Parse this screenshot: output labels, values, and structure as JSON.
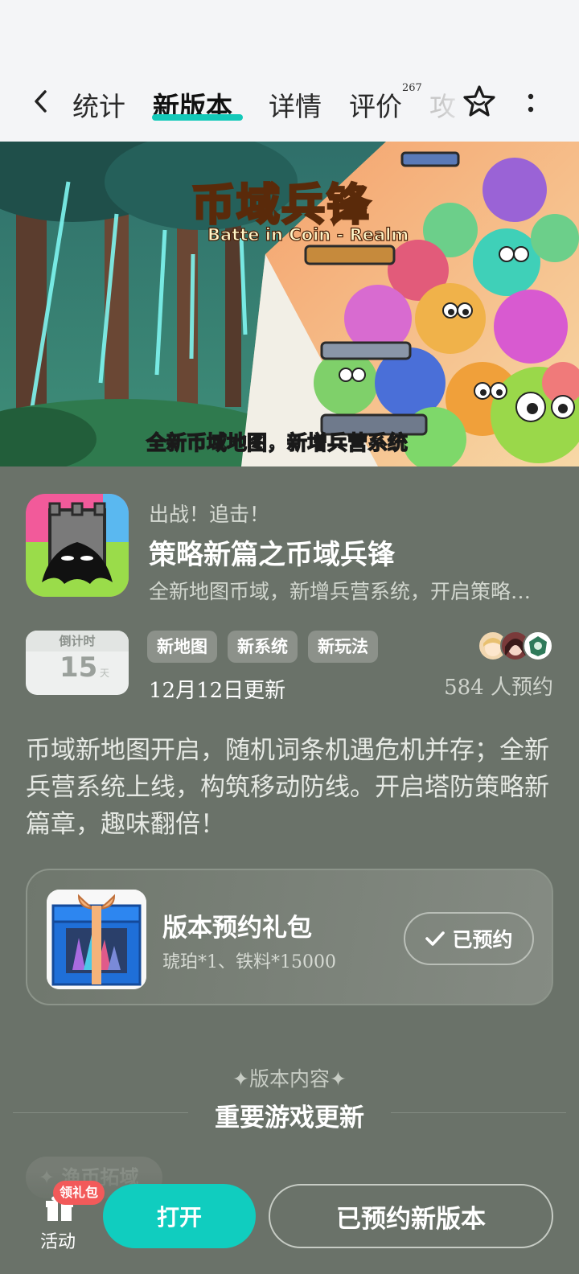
{
  "nav": {
    "tabs": [
      {
        "label": "统计"
      },
      {
        "label": "新版本",
        "active": true
      },
      {
        "label": "详情"
      },
      {
        "label": "评价",
        "badge": "267"
      },
      {
        "label": "攻"
      }
    ]
  },
  "banner": {
    "title": "币域兵锋",
    "subtitle": "Batte in Coin - Realm",
    "caption": "全新币域地图，新增兵营系统"
  },
  "app": {
    "eyebrow": "出战！追击！",
    "title": "策略新篇之币域兵锋",
    "subtitle": "全新地图币域，新增兵营系统，开启策略新篇章，趣味翻倍！"
  },
  "countdown": {
    "header": "倒计时",
    "number": "15",
    "unit": "天"
  },
  "tags": [
    "新地图",
    "新系统",
    "新玩法"
  ],
  "update_date": "12月12日更新",
  "reserve_count": "584 人预约",
  "description": "币域新地图开启，随机词条机遇危机并存；全新兵营系统上线，构筑移动防线。开启塔防策略新篇章，趣味翻倍！",
  "gift": {
    "title": "版本预约礼包",
    "desc": "琥珀*1、铁料*15000",
    "button": "已预约"
  },
  "section": {
    "kicker": "✦版本内容✦",
    "title": "重要游戏更新",
    "partial_chip": "✦ 渔币拓域"
  },
  "bottom": {
    "activity_label": "活动",
    "gift_badge": "领礼包",
    "open_button": "打开",
    "reserved_version_button": "已预约新版本"
  },
  "colors": {
    "accent": "#10cdbf",
    "background": "#6a7269",
    "badge": "#f25a5a"
  }
}
